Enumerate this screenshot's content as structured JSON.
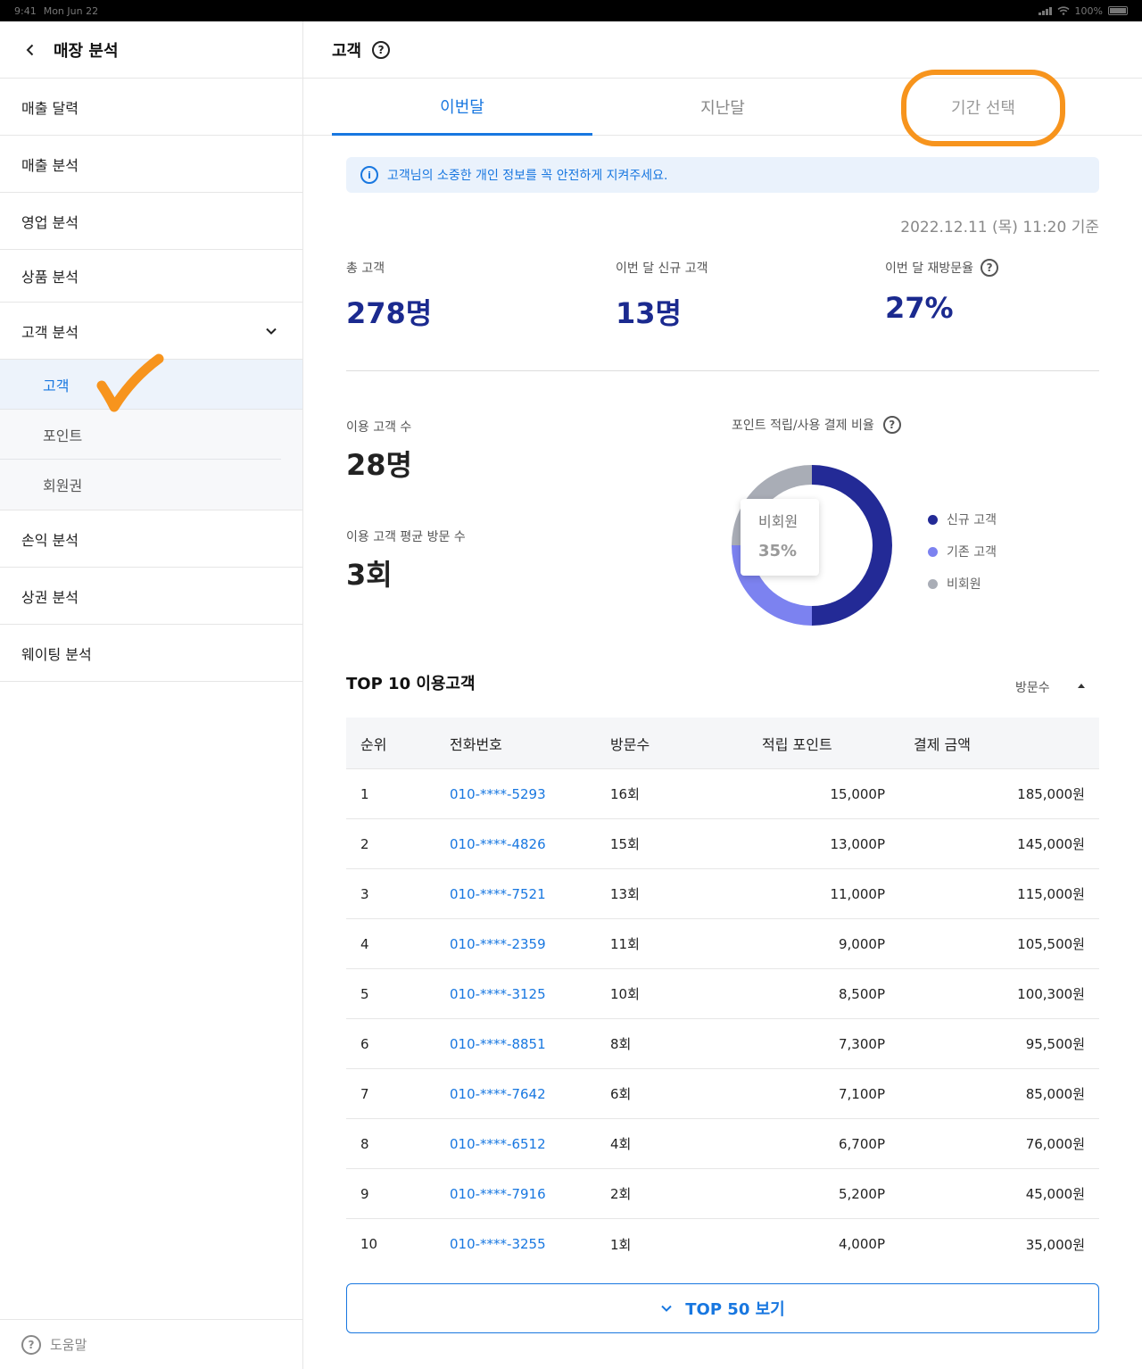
{
  "status_bar": {
    "time": "9:41",
    "date": "Mon Jun 22",
    "battery": "100%"
  },
  "sidebar": {
    "title": "매장 분석",
    "items": [
      {
        "label": "매출 달력"
      },
      {
        "label": "매출 분석"
      },
      {
        "label": "영업 분석"
      },
      {
        "label": "상품 분석"
      },
      {
        "label": "고객 분석"
      }
    ],
    "sub_items": [
      {
        "label": "고객",
        "active": true
      },
      {
        "label": "포인트"
      },
      {
        "label": "회원권"
      }
    ],
    "items_after": [
      {
        "label": "손익 분석"
      },
      {
        "label": "상권 분석"
      },
      {
        "label": "웨이팅 분석"
      }
    ],
    "help_label": "도움말"
  },
  "main": {
    "title": "고객",
    "tabs": [
      {
        "label": "이번달"
      },
      {
        "label": "지난달"
      },
      {
        "label": "기간 선택"
      }
    ],
    "notice": "고객님의 소중한 개인 정보를 꼭 안전하게 지켜주세요.",
    "timestamp": "2022.12.11 (목) 11:20 기준",
    "stats": [
      {
        "label": "총 고객",
        "value": "278명"
      },
      {
        "label": "이번 달 신규 고객",
        "value": "13명"
      },
      {
        "label": "이번 달 재방문율",
        "value": "27%"
      }
    ],
    "usage": {
      "customers_label": "이용 고객 수",
      "customers_value": "28명",
      "avg_visits_label": "이용 고객 평균 방문 수",
      "avg_visits_value": "3회"
    },
    "donut": {
      "title": "포인트 적립/사용 결제 비율",
      "tooltip_label": "비회원",
      "tooltip_value": "35%",
      "legend": [
        {
          "label": "신규 고객",
          "color": "#232a96"
        },
        {
          "label": "기존 고객",
          "color": "#7c82f0"
        },
        {
          "label": "비회원",
          "color": "#a9adb6"
        }
      ]
    },
    "top10": {
      "title": "TOP 10 이용고객",
      "sort_label": "방문수",
      "headers": [
        "순위",
        "전화번호",
        "방문수",
        "적립 포인트",
        "결제 금액"
      ],
      "rows": [
        {
          "rank": "1",
          "phone": "010-****-5293",
          "visits": "16회",
          "points": "15,000P",
          "amount": "185,000원"
        },
        {
          "rank": "2",
          "phone": "010-****-4826",
          "visits": "15회",
          "points": "13,000P",
          "amount": "145,000원"
        },
        {
          "rank": "3",
          "phone": "010-****-7521",
          "visits": "13회",
          "points": "11,000P",
          "amount": "115,000원"
        },
        {
          "rank": "4",
          "phone": "010-****-2359",
          "visits": "11회",
          "points": "9,000P",
          "amount": "105,500원"
        },
        {
          "rank": "5",
          "phone": "010-****-3125",
          "visits": "10회",
          "points": "8,500P",
          "amount": "100,300원"
        },
        {
          "rank": "6",
          "phone": "010-****-8851",
          "visits": "8회",
          "points": "7,300P",
          "amount": "95,500원"
        },
        {
          "rank": "7",
          "phone": "010-****-7642",
          "visits": "6회",
          "points": "7,100P",
          "amount": "85,000원"
        },
        {
          "rank": "8",
          "phone": "010-****-6512",
          "visits": "4회",
          "points": "6,700P",
          "amount": "76,000원"
        },
        {
          "rank": "9",
          "phone": "010-****-7916",
          "visits": "2회",
          "points": "5,200P",
          "amount": "45,000원"
        },
        {
          "rank": "10",
          "phone": "010-****-3255",
          "visits": "1회",
          "points": "4,000P",
          "amount": "35,000원"
        }
      ]
    },
    "more_button": "TOP 50 보기"
  }
}
